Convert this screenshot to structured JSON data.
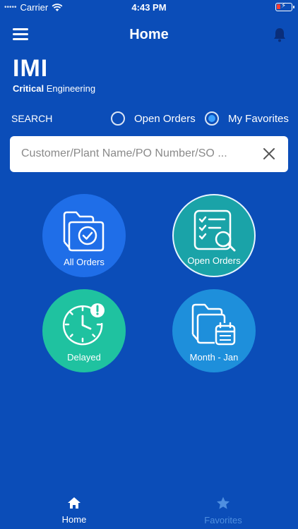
{
  "status_bar": {
    "carrier": "Carrier",
    "time": "4:43 PM"
  },
  "nav": {
    "title": "Home"
  },
  "logo": {
    "brand": "IMI",
    "sub_bold": "Critical",
    "sub_rest": "Engineering"
  },
  "search": {
    "label": "SEARCH",
    "options": [
      {
        "label": "Open Orders",
        "selected": false
      },
      {
        "label": "My Favorites",
        "selected": true
      }
    ],
    "placeholder": "Customer/Plant Name/PO Number/SO ..."
  },
  "tiles": [
    {
      "label": "All Orders",
      "icon": "folder-check-icon",
      "color": "#1f6ee8"
    },
    {
      "label": "Open Orders",
      "icon": "checklist-search-icon",
      "color": "#1aa3a8"
    },
    {
      "label": "Delayed",
      "icon": "clock-alert-icon",
      "color": "#1fc2a0"
    },
    {
      "label": "Month - Jan",
      "icon": "folder-calendar-icon",
      "color": "#1e8fdb"
    }
  ],
  "tab_bar": {
    "items": [
      {
        "label": "Home",
        "icon": "home-icon",
        "active": true
      },
      {
        "label": "Favorites",
        "icon": "star-icon",
        "active": false
      }
    ]
  },
  "colors": {
    "background": "#0b4db8",
    "active_tab": "#ffffff",
    "inactive_tab": "#4f8fe0",
    "radio_checked": "#3aa0ff"
  }
}
